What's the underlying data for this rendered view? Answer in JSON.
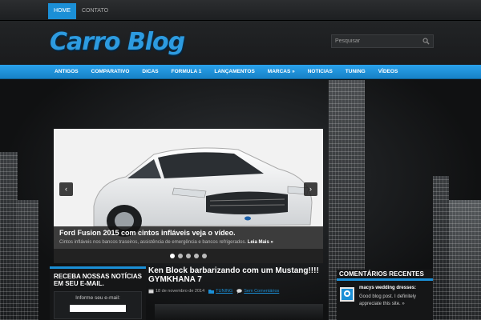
{
  "topbar": {
    "items": [
      "HOME",
      "CONTATO"
    ],
    "active_index": 0
  },
  "header": {
    "logo": "Carro Blog",
    "search_placeholder": "Pesquisar"
  },
  "main_nav": {
    "items": [
      "ANTIGOS",
      "COMPARATIVO",
      "DICAS",
      "FORMULA 1",
      "LANÇAMENTOS",
      "MARCAS »",
      "NOTICIAS",
      "TUNING",
      "VÍDEOS"
    ]
  },
  "slider": {
    "title": "Ford Fusion 2015 com cintos infláveis veja o vídeo.",
    "text": "Cintos infláveis nos bancos traseiros, assistência de emergência e bancos refrigerados.",
    "more": "Leia Mais »",
    "prev": "‹",
    "next": "›",
    "slide_count": 5,
    "active_slide": 0
  },
  "newsletter": {
    "heading": "RECEBA NOSSAS NOTÍCIAS EM SEU E-MAIL.",
    "label": "Informe seu e-mail:",
    "value": ""
  },
  "post": {
    "title": "Ken Block barbarizando com um Mustang!!!! GYMKHANA 7",
    "date": "18 de novembro de 2014",
    "category": "TUNING",
    "comments": "Sem Comentários"
  },
  "recent_comments": {
    "heading": "COMENTÁRIOS RECENTES",
    "items": [
      {
        "author": "macys wedding dresses:",
        "text": "Good blog post. I definitely appreciate this site. »"
      }
    ]
  },
  "colors": {
    "accent": "#1b8fd6",
    "background": "#101112"
  }
}
